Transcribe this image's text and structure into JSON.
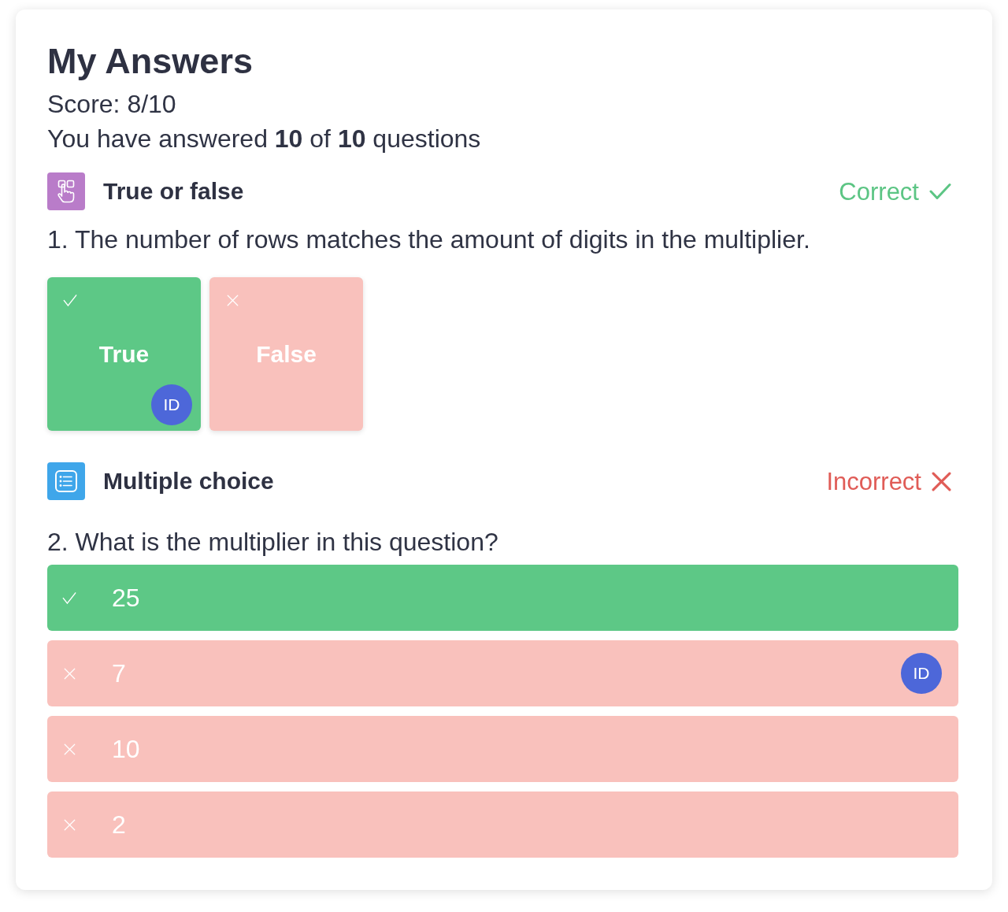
{
  "title": "My Answers",
  "score": "Score: 8/10",
  "progress": "You have answered **10** of **10** questions",
  "questions": [
    {
      "kind": "true_false",
      "type_label": "True or false",
      "correct": true,
      "result_label": "Correct",
      "prompt": "1. The number of rows matches the amount of digits in the multiplier.",
      "answered_by": "ID",
      "options": [
        {
          "label": "True",
          "correct": true,
          "selected": true
        },
        {
          "label": "False",
          "correct": false,
          "selected": false
        }
      ]
    },
    {
      "kind": "multiple_choice",
      "type_label": "Multiple choice",
      "correct": false,
      "result_label": "Incorrect",
      "prompt": "2. What is the multiplier in this question?",
      "answered_by": "ID",
      "options": [
        {
          "label": "25",
          "correct": true,
          "selected": false
        },
        {
          "label": "7",
          "correct": false,
          "selected": true
        },
        {
          "label": "10",
          "correct": false,
          "selected": false
        },
        {
          "label": "2",
          "correct": false,
          "selected": false
        }
      ]
    }
  ]
}
